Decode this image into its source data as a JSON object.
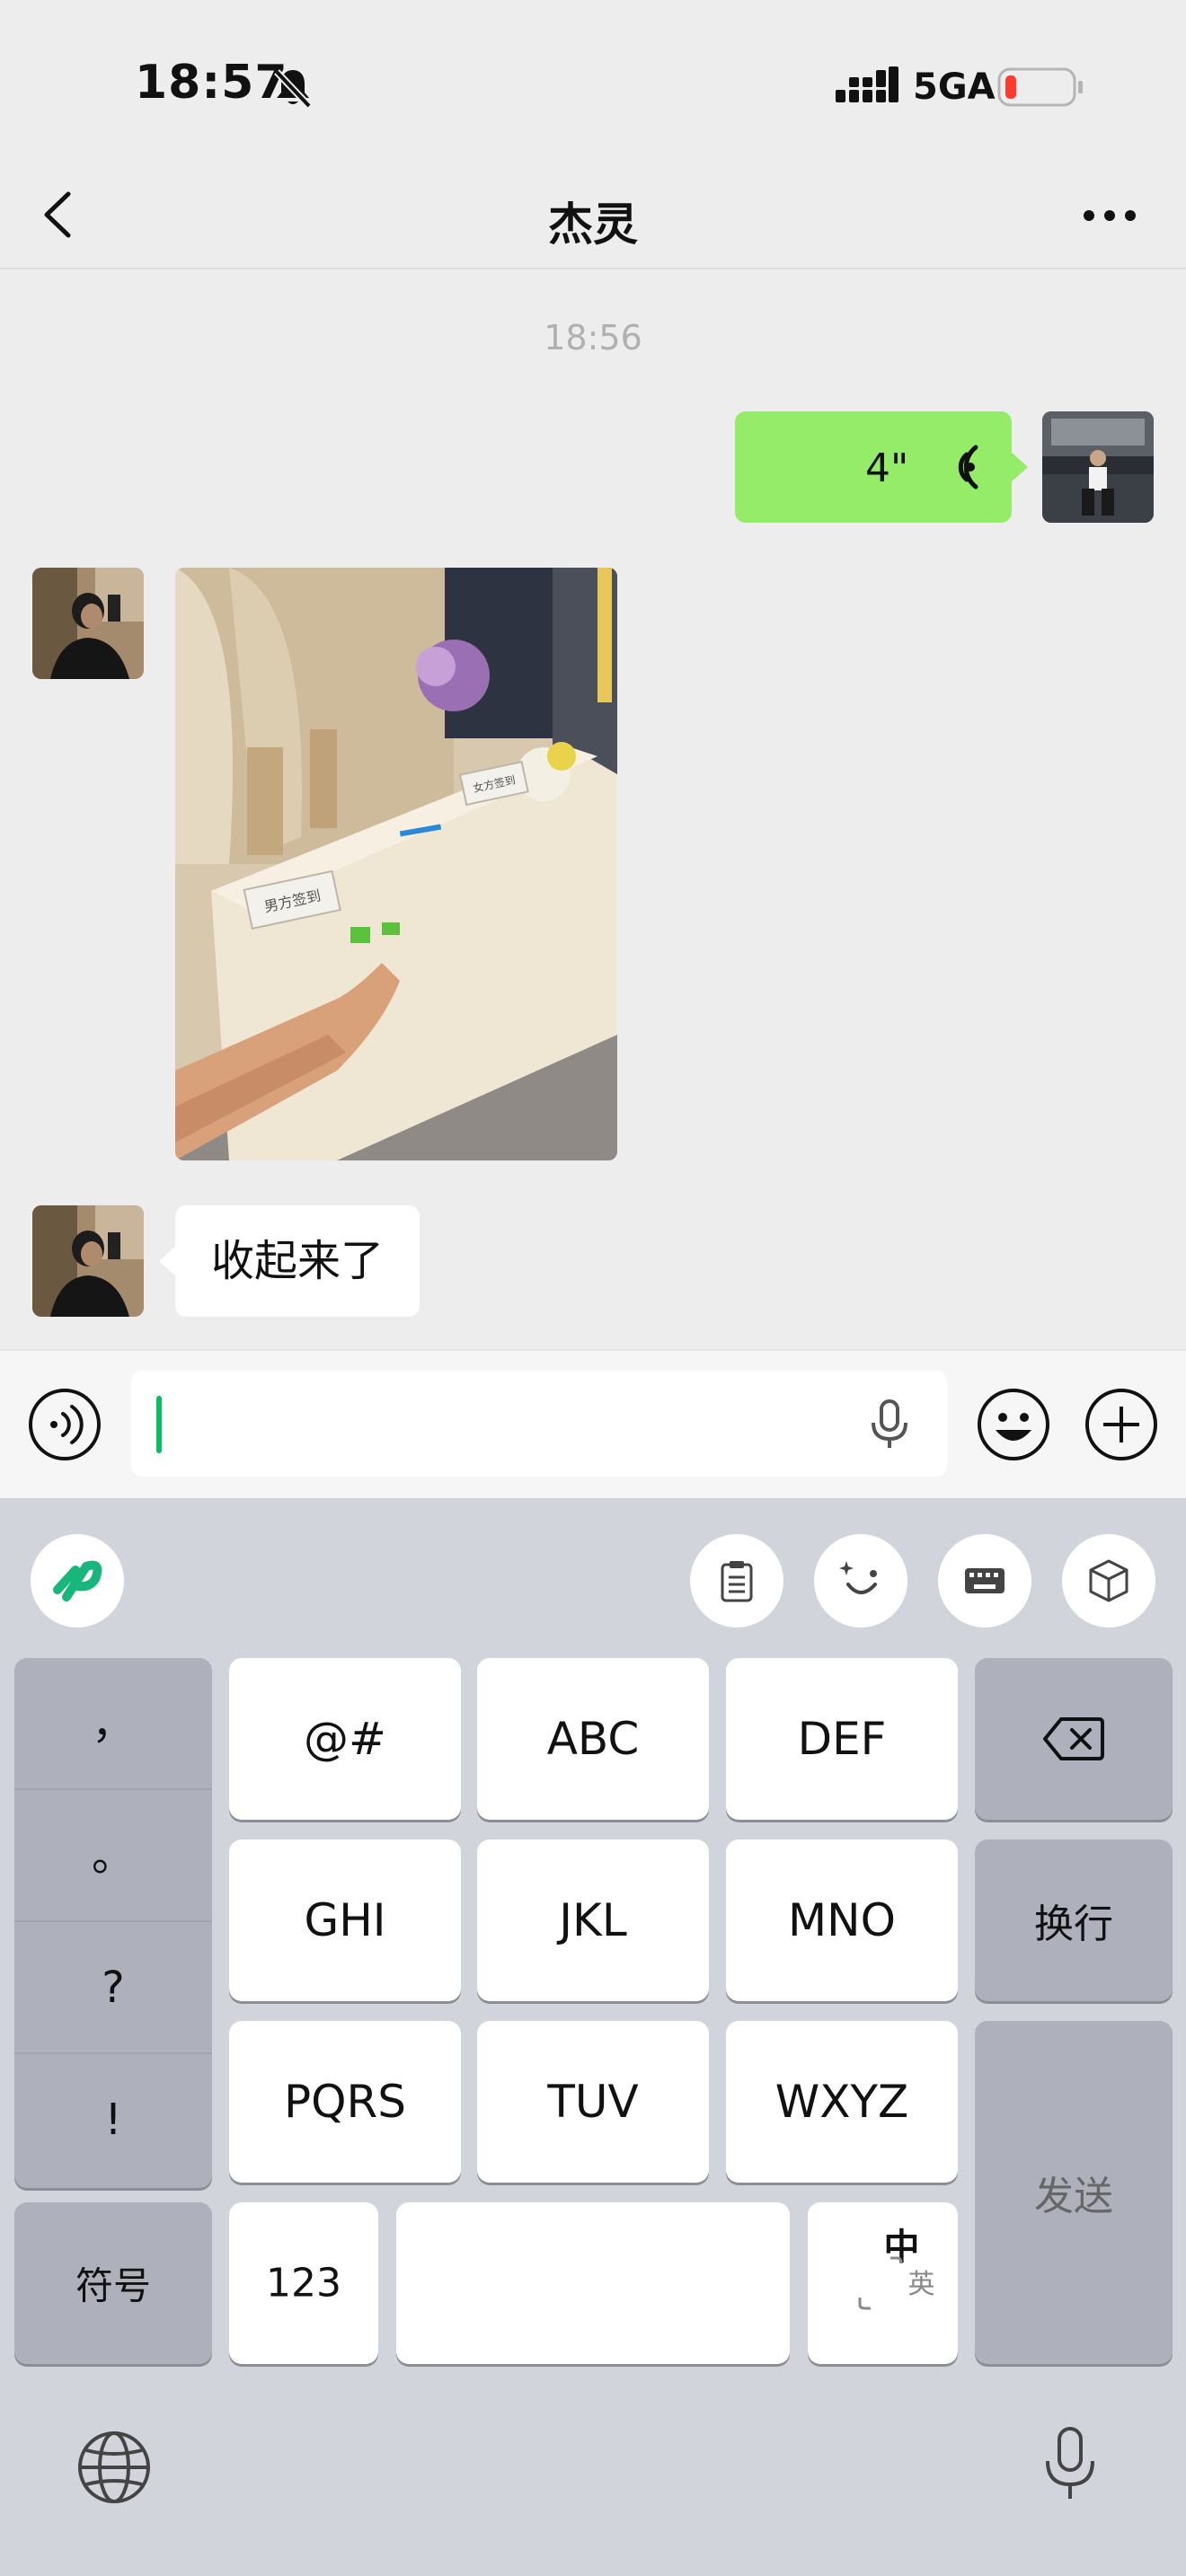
{
  "status_bar": {
    "time": "18:57",
    "network": "5GA"
  },
  "nav": {
    "title": "杰灵"
  },
  "chat": {
    "timestamp": "18:56",
    "voice_message": {
      "duration": "4\""
    },
    "text_message": "收起来了",
    "photo_sign_left": "男方签到",
    "photo_sign_right": "女方签到"
  },
  "keyboard": {
    "punct_keys": [
      "，",
      "。",
      "?",
      "!"
    ],
    "symbol_key": "符号",
    "rows": [
      [
        "@#",
        "ABC",
        "DEF"
      ],
      [
        "GHI",
        "JKL",
        "MNO"
      ],
      [
        "PQRS",
        "TUV",
        "WXYZ"
      ]
    ],
    "newline_key": "换行",
    "send_key": "发送",
    "num_key": "123",
    "lang_zh": "中",
    "lang_en": "英"
  },
  "colors": {
    "self_bubble": "#95ec69",
    "accent": "#07c160",
    "battery_low": "#ff3b30"
  }
}
